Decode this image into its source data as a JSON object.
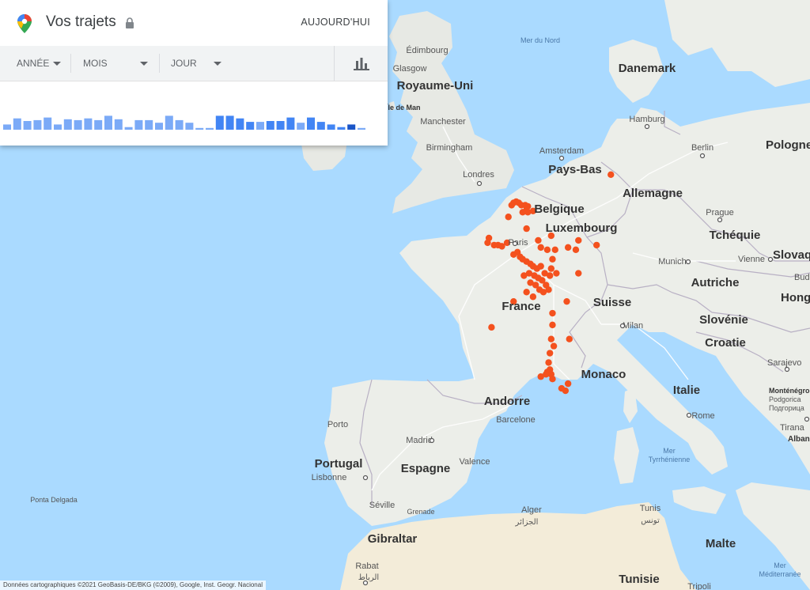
{
  "panel": {
    "title": "Vos trajets",
    "today_label": "AUJOURD'HUI",
    "filters": [
      {
        "label": "ANNÉE"
      },
      {
        "label": "MOIS"
      },
      {
        "label": "JOUR"
      }
    ],
    "chart_icon": "bar-chart-icon",
    "lock_icon": "lock-icon",
    "logo_icon": "maps-pin-icon",
    "bars": [
      {
        "level": 0.3,
        "shade": "light"
      },
      {
        "level": 0.65,
        "shade": "light"
      },
      {
        "level": 0.5,
        "shade": "light"
      },
      {
        "level": 0.55,
        "shade": "light"
      },
      {
        "level": 0.7,
        "shade": "light"
      },
      {
        "level": 0.3,
        "shade": "light"
      },
      {
        "level": 0.6,
        "shade": "light"
      },
      {
        "level": 0.55,
        "shade": "light"
      },
      {
        "level": 0.65,
        "shade": "light"
      },
      {
        "level": 0.55,
        "shade": "light"
      },
      {
        "level": 0.8,
        "shade": "light"
      },
      {
        "level": 0.6,
        "shade": "light"
      },
      {
        "level": 0.15,
        "shade": "light"
      },
      {
        "level": 0.55,
        "shade": "light"
      },
      {
        "level": 0.55,
        "shade": "light"
      },
      {
        "level": 0.4,
        "shade": "light"
      },
      {
        "level": 0.8,
        "shade": "light"
      },
      {
        "level": 0.55,
        "shade": "light"
      },
      {
        "level": 0.4,
        "shade": "light"
      },
      {
        "level": 0.1,
        "shade": "light"
      },
      {
        "level": 0.1,
        "shade": "light"
      },
      {
        "level": 0.8,
        "shade": "dark"
      },
      {
        "level": 0.8,
        "shade": "dark"
      },
      {
        "level": 0.65,
        "shade": "dark"
      },
      {
        "level": 0.45,
        "shade": "dark"
      },
      {
        "level": 0.45,
        "shade": "light"
      },
      {
        "level": 0.5,
        "shade": "dark"
      },
      {
        "level": 0.5,
        "shade": "dark"
      },
      {
        "level": 0.7,
        "shade": "dark"
      },
      {
        "level": 0.4,
        "shade": "light"
      },
      {
        "level": 0.7,
        "shade": "dark"
      },
      {
        "level": 0.45,
        "shade": "dark"
      },
      {
        "level": 0.3,
        "shade": "dark"
      },
      {
        "level": 0.15,
        "shade": "dark"
      },
      {
        "level": 0.3,
        "shade": "navy"
      },
      {
        "level": 0.1,
        "shade": "light"
      }
    ]
  },
  "map": {
    "countries": [
      {
        "name": "Royaume-Uni"
      },
      {
        "name": "Danemark"
      },
      {
        "name": "Pays-Bas"
      },
      {
        "name": "Allemagne"
      },
      {
        "name": "Pologne"
      },
      {
        "name": "Belgique"
      },
      {
        "name": "Luxembourg"
      },
      {
        "name": "Tchéquie"
      },
      {
        "name": "Slovaq"
      },
      {
        "name": "Autriche"
      },
      {
        "name": "Hong"
      },
      {
        "name": "France"
      },
      {
        "name": "Suisse"
      },
      {
        "name": "Slovénie"
      },
      {
        "name": "Croatie"
      },
      {
        "name": "Monaco"
      },
      {
        "name": "Italie"
      },
      {
        "name": "Andorre"
      },
      {
        "name": "Portugal"
      },
      {
        "name": "Espagne"
      },
      {
        "name": "Gibraltar"
      },
      {
        "name": "Malte"
      },
      {
        "name": "Tunisie"
      }
    ],
    "cities": [
      {
        "name": "Édimbourg"
      },
      {
        "name": "Glasgow"
      },
      {
        "name": "Île de Man"
      },
      {
        "name": "Manchester"
      },
      {
        "name": "Birmingham"
      },
      {
        "name": "Londres"
      },
      {
        "name": "Hamburg"
      },
      {
        "name": "Amsterdam"
      },
      {
        "name": "Berlin"
      },
      {
        "name": "Prague"
      },
      {
        "name": "Paris"
      },
      {
        "name": "Munich"
      },
      {
        "name": "Vienne"
      },
      {
        "name": "Budapest"
      },
      {
        "name": "Milan"
      },
      {
        "name": "Sarajevo"
      },
      {
        "name": "Monténégro"
      },
      {
        "name": "Podgorica"
      },
      {
        "name": "Подгорица"
      },
      {
        "name": "Tirana"
      },
      {
        "name": "Alban"
      },
      {
        "name": "Rome"
      },
      {
        "name": "Porto"
      },
      {
        "name": "Barcelone"
      },
      {
        "name": "Madrid"
      },
      {
        "name": "Valence"
      },
      {
        "name": "Lisbonne"
      },
      {
        "name": "Ponta Delgada"
      },
      {
        "name": "Séville"
      },
      {
        "name": "Grenade"
      },
      {
        "name": "Alger"
      },
      {
        "name": "الجزائر"
      },
      {
        "name": "Tunis"
      },
      {
        "name": "تونس"
      },
      {
        "name": "Rabat"
      },
      {
        "name": "الرباط"
      },
      {
        "name": "Tripoli"
      }
    ],
    "seas": [
      {
        "name": "Mer du Nord"
      },
      {
        "name": "Mer Tyrrhénienne"
      },
      {
        "name": "Mer Méditerranée"
      }
    ],
    "visit_dot_color": "#f4511e",
    "visit_dots": [
      [
        2.0,
        51.0
      ],
      [
        2.2,
        51.05
      ],
      [
        1.85,
        50.9
      ],
      [
        2.4,
        51.0
      ],
      [
        2.6,
        50.9
      ],
      [
        3.0,
        50.7
      ],
      [
        3.1,
        50.6
      ],
      [
        2.9,
        50.9
      ],
      [
        3.5,
        50.65
      ],
      [
        3.1,
        50.85
      ],
      [
        2.7,
        50.6
      ],
      [
        1.6,
        50.4
      ],
      [
        0.1,
        49.5
      ],
      [
        0.0,
        49.3
      ],
      [
        0.5,
        49.2
      ],
      [
        0.8,
        49.2
      ],
      [
        1.1,
        49.15
      ],
      [
        1.5,
        49.3
      ],
      [
        2.3,
        48.9
      ],
      [
        2.0,
        48.8
      ],
      [
        2.5,
        48.7
      ],
      [
        2.7,
        48.6
      ],
      [
        3.0,
        48.5
      ],
      [
        3.3,
        48.4
      ],
      [
        3.5,
        48.3
      ],
      [
        3.8,
        48.2
      ],
      [
        4.1,
        48.3
      ],
      [
        4.4,
        48.0
      ],
      [
        3.2,
        48.0
      ],
      [
        3.6,
        47.9
      ],
      [
        3.9,
        47.8
      ],
      [
        4.2,
        47.7
      ],
      [
        2.8,
        47.9
      ],
      [
        3.3,
        47.6
      ],
      [
        3.7,
        47.5
      ],
      [
        4.0,
        47.3
      ],
      [
        4.3,
        47.2
      ],
      [
        3.0,
        47.2
      ],
      [
        3.5,
        47.0
      ],
      [
        4.5,
        47.5
      ],
      [
        4.7,
        47.3
      ],
      [
        4.8,
        47.9
      ],
      [
        4.9,
        48.2
      ],
      [
        5.3,
        48.0
      ],
      [
        5.0,
        48.6
      ],
      [
        4.1,
        49.1
      ],
      [
        4.6,
        49.0
      ],
      [
        5.2,
        49.0
      ],
      [
        6.2,
        49.1
      ],
      [
        6.8,
        49.0
      ],
      [
        4.9,
        49.6
      ],
      [
        3.9,
        49.4
      ],
      [
        3.0,
        49.9
      ],
      [
        7.0,
        49.4
      ],
      [
        8.4,
        49.2
      ],
      [
        9.5,
        52.2
      ],
      [
        7.0,
        48.0
      ],
      [
        6.1,
        46.8
      ],
      [
        5.0,
        46.3
      ],
      [
        5.0,
        45.8
      ],
      [
        4.9,
        45.2
      ],
      [
        5.1,
        44.9
      ],
      [
        4.8,
        44.6
      ],
      [
        4.7,
        44.2
      ],
      [
        4.8,
        43.9
      ],
      [
        4.6,
        43.8
      ],
      [
        4.9,
        43.7
      ],
      [
        5.0,
        43.5
      ],
      [
        4.5,
        43.7
      ],
      [
        4.1,
        43.6
      ],
      [
        6.2,
        43.3
      ],
      [
        6.0,
        43.0
      ],
      [
        5.7,
        43.1
      ],
      [
        6.3,
        45.2
      ],
      [
        2.0,
        46.8
      ],
      [
        0.3,
        45.7
      ]
    ]
  },
  "credit": "Données cartographiques ©2021 GeoBasis-DE/BKG (©2009), Google, Inst. Geogr. Nacional"
}
